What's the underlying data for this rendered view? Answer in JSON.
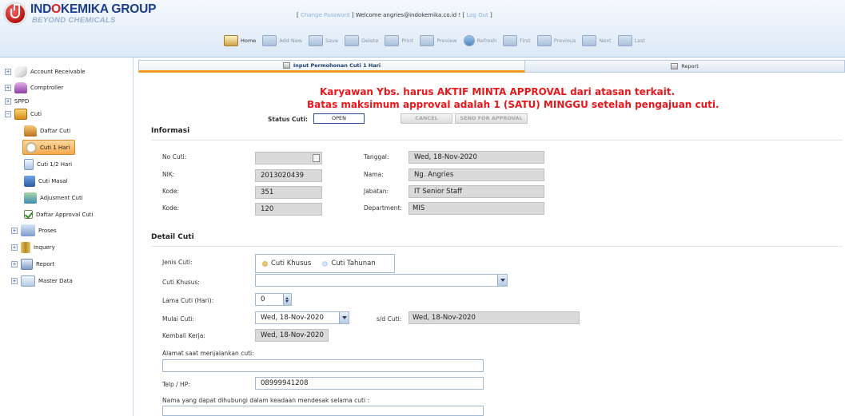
{
  "header": {
    "brand_name": "INDOKEMIKA GROUP",
    "brand_prefix": "IND",
    "brand_o": "O",
    "brand_suffix": "KEMIKA GROUP",
    "tagline": "BEYOND CHEMICALS",
    "change_password_label": "Change Password",
    "welcome_text": "Welcome angries@indokemika.co.id !",
    "logout_label": "Log Out"
  },
  "toolbar": {
    "home": "Home",
    "add_new": "Add New",
    "save": "Save",
    "delete": "Delete",
    "print": "Print",
    "preview": "Preview",
    "refresh": "Refresh",
    "first": "First",
    "previous": "Previous",
    "next": "Next",
    "last": "Last"
  },
  "sidebar": {
    "account_receivable": "Account Receivable",
    "comptroller": "Comptroller",
    "sppd": "SPPD",
    "cuti": "Cuti",
    "daftar_cuti": "Daftar Cuti",
    "cuti_1_hari": "Cuti 1 Hari",
    "cuti_half_hari": "Cuti 1/2 Hari",
    "cuti_masal": "Cuti Masal",
    "adjusment_cuti": "Adjusment Cuti",
    "daftar_approval_cuti": "Daftar Approval Cuti",
    "proses": "Proses",
    "inquery": "Inquery",
    "report": "Report",
    "master_data": "Master Data",
    "expand_symbol": "+",
    "collapse_symbol": "−"
  },
  "tabs": {
    "input": "Input Permohonan Cuti 1 Hari",
    "report": "Report"
  },
  "warning": {
    "line1": "Karyawan Ybs. harus AKTIF MINTA APPROVAL dari atasan terkait.",
    "line2": "Batas maksimum approval adalah 1 (SATU) MINGGU setelah pengajuan cuti."
  },
  "status": {
    "label": "Status Cuti:",
    "value": "OPEN",
    "cancel_label": "CANCEL",
    "send_label": "SEND FOR APPROVAL"
  },
  "informasi": {
    "title": "Informasi",
    "no_cuti_label": "No Cuti:",
    "no_cuti_value": "",
    "tanggal_label": "Tanggal:",
    "tanggal_value": "Wed, 18-Nov-2020",
    "nik_label": "NIK:",
    "nik_value": "2013020439",
    "nama_label": "Nama:",
    "nama_value": "Ng. Angries",
    "kode1_label": "Kode:",
    "kode1_value": "351",
    "jabatan_label": "Jabatan:",
    "jabatan_value": "IT Senior Staff",
    "kode2_label": "Kode:",
    "kode2_value": "120",
    "department_label": "Department:",
    "department_value": "MIS"
  },
  "detail": {
    "title": "Detail Cuti",
    "jenis_label": "Jenis Cuti:",
    "jenis_option1": "Cuti Khusus",
    "jenis_option2": "Cuti Tahunan",
    "jenis_selected": "Cuti Khusus",
    "cuti_khusus_label": "Cuti Khusus:",
    "cuti_khusus_value": "",
    "lama_label": "Lama Cuti (Hari):",
    "lama_value": "0",
    "mulai_label": "Mulai Cuti:",
    "mulai_value": "Wed, 18-Nov-2020",
    "sd_label": "s/d Cuti:",
    "sd_value": "Wed, 18-Nov-2020",
    "kembali_label": "Kembali Kerja:",
    "kembali_value": "Wed, 18-Nov-2020",
    "alamat_label": "Alamat saat menjalankan cuti:",
    "alamat_value": "",
    "telp_label": "Telp / HP:",
    "telp_value": "08999941208",
    "kontak_label": "Nama yang dapat dihubungi dalam keadaan mendesak selama cuti :",
    "kontak_value": ""
  },
  "colors": {
    "warning_red": "#e8171b",
    "selected_orange": "#f6a94b",
    "brand_blue": "#1c3c8c"
  }
}
